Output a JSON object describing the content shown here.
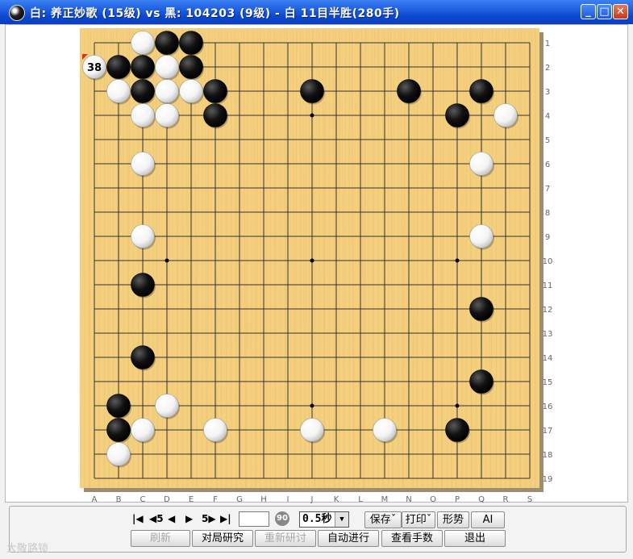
{
  "window": {
    "title": "白: 养正妙歌 (15级) vs 黑: 104203 (9级) - 白 11目半胜(280手)",
    "minimize_icon": "minimize-icon",
    "maximize_icon": "maximize-icon",
    "close_icon": "close-icon"
  },
  "board": {
    "size": 19,
    "col_labels": [
      "A",
      "B",
      "C",
      "D",
      "E",
      "F",
      "G",
      "H",
      "I",
      "J",
      "K",
      "L",
      "M",
      "N",
      "O",
      "P",
      "Q",
      "R",
      "S"
    ],
    "row_labels": [
      "1",
      "2",
      "3",
      "4",
      "5",
      "6",
      "7",
      "8",
      "9",
      "10",
      "11",
      "12",
      "13",
      "14",
      "15",
      "16",
      "17",
      "18",
      "19"
    ],
    "star_points": [
      [
        "D",
        10
      ],
      [
        "J",
        4
      ],
      [
        "P",
        10
      ],
      [
        "J",
        10
      ],
      [
        "J",
        16
      ],
      [
        "P",
        16
      ]
    ],
    "black_stones": [
      [
        "D",
        1
      ],
      [
        "E",
        1
      ],
      [
        "B",
        2
      ],
      [
        "C",
        2
      ],
      [
        "E",
        2
      ],
      [
        "C",
        3
      ],
      [
        "F",
        3
      ],
      [
        "F",
        4
      ],
      [
        "J",
        3
      ],
      [
        "N",
        3
      ],
      [
        "Q",
        3
      ],
      [
        "P",
        4
      ],
      [
        "C",
        11
      ],
      [
        "Q",
        12
      ],
      [
        "C",
        14
      ],
      [
        "Q",
        15
      ],
      [
        "B",
        16
      ],
      [
        "B",
        17
      ],
      [
        "P",
        17
      ]
    ],
    "white_stones": [
      [
        "C",
        1
      ],
      [
        "D",
        2
      ],
      [
        "B",
        3
      ],
      [
        "D",
        3
      ],
      [
        "E",
        3
      ],
      [
        "C",
        4
      ],
      [
        "D",
        4
      ],
      [
        "R",
        4
      ],
      [
        "C",
        6
      ],
      [
        "Q",
        6
      ],
      [
        "C",
        9
      ],
      [
        "Q",
        9
      ],
      [
        "D",
        16
      ],
      [
        "C",
        17
      ],
      [
        "F",
        17
      ],
      [
        "J",
        17
      ],
      [
        "M",
        17
      ],
      [
        "B",
        18
      ]
    ],
    "last_move": {
      "point": [
        "A",
        2
      ],
      "color": "white",
      "number": "38"
    },
    "colors": {
      "wood": "#f3cf7e",
      "line": "#333333",
      "black_stone": "#111111",
      "white_stone": "#f4f4f4",
      "last_move_marker": "#e03020"
    }
  },
  "controls": {
    "nav": {
      "first": "|◀",
      "back5": "◀5",
      "prev": "◀",
      "next": "▶",
      "fwd5": "5▶",
      "last": "▶|"
    },
    "move_number_value": "",
    "badge": "90",
    "time_select": "0.5秒",
    "buttons_row1": [
      "保存ˇ",
      "打印ˇ",
      "形势",
      "AI"
    ],
    "buttons_row2": [
      "刷新",
      "对局研究",
      "重新研讨",
      "自动进行",
      "查看手数",
      "退出"
    ]
  },
  "watermark": "大敬路锁"
}
